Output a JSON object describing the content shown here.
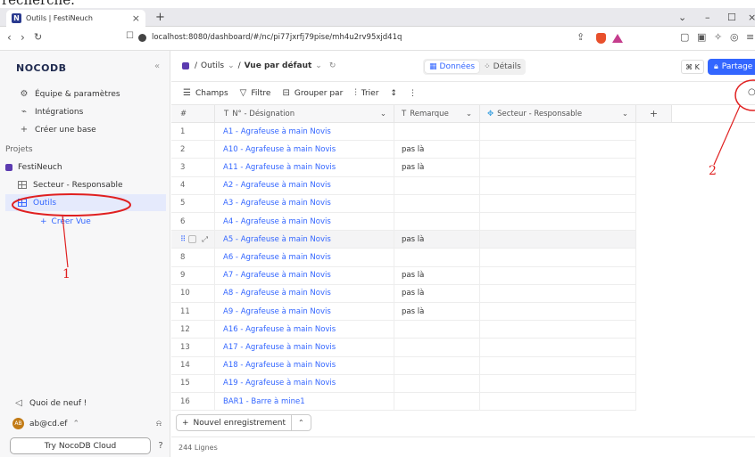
{
  "top_text": "recherche.",
  "browser": {
    "tab_title": "Outils | FestiNeuch",
    "favicon": "N",
    "url": "localhost:8080/dashboard/#/nc/pi77jxrfj79pise/mh4u2rv95xjd41q"
  },
  "sidebar": {
    "logo": "NOCODB",
    "items": [
      {
        "label": "Équipe & paramètres",
        "icon": "gear-icon"
      },
      {
        "label": "Intégrations",
        "icon": "plug-icon"
      },
      {
        "label": "Créer une base",
        "icon": "plus-icon"
      }
    ],
    "projects_heading": "Projets",
    "project_name": "FestiNeuch",
    "tables": [
      "Secteur - Responsable",
      "Outils"
    ],
    "create_view": "Créer Vue",
    "whats_new": "Quoi de neuf !",
    "user": "ab@cd.ef",
    "user_initials": "AB",
    "try_cloud": "Try NocoDB Cloud"
  },
  "topbar": {
    "table": "Outils",
    "view": "Vue par défaut",
    "tab_data": "Données",
    "tab_details": "Détails",
    "shortcut": "⌘ K",
    "share": "Partage"
  },
  "toolbar": {
    "fields": "Champs",
    "filter": "Filtre",
    "group": "Grouper par",
    "sort": "Trier"
  },
  "grid": {
    "columns": [
      "#",
      "N° - Désignation",
      "Remarque",
      "Secteur - Responsable"
    ],
    "rows": [
      {
        "n": "1",
        "des": "A1 - Agrafeuse à main Novis",
        "rem": ""
      },
      {
        "n": "2",
        "des": "A10 - Agrafeuse à main Novis",
        "rem": "pas là"
      },
      {
        "n": "3",
        "des": "A11 - Agrafeuse à main Novis",
        "rem": "pas là"
      },
      {
        "n": "4",
        "des": "A2 - Agrafeuse à main Novis",
        "rem": ""
      },
      {
        "n": "5",
        "des": "A3 - Agrafeuse à main Novis",
        "rem": ""
      },
      {
        "n": "6",
        "des": "A4 - Agrafeuse à main Novis",
        "rem": ""
      },
      {
        "n": "7",
        "des": "A5 - Agrafeuse à main Novis",
        "rem": "pas là"
      },
      {
        "n": "8",
        "des": "A6 - Agrafeuse à main Novis",
        "rem": ""
      },
      {
        "n": "9",
        "des": "A7 - Agrafeuse à main Novis",
        "rem": "pas là"
      },
      {
        "n": "10",
        "des": "A8 - Agrafeuse à main Novis",
        "rem": "pas là"
      },
      {
        "n": "11",
        "des": "A9 - Agrafeuse à main Novis",
        "rem": "pas là"
      },
      {
        "n": "12",
        "des": "A16 - Agrafeuse à main Novis",
        "rem": ""
      },
      {
        "n": "13",
        "des": "A17 - Agrafeuse à main Novis",
        "rem": ""
      },
      {
        "n": "14",
        "des": "A18 - Agrafeuse à main Novis",
        "rem": ""
      },
      {
        "n": "15",
        "des": "A19 - Agrafeuse à main Novis",
        "rem": ""
      },
      {
        "n": "16",
        "des": "BAR1 - Barre à mine1",
        "rem": ""
      }
    ],
    "new_record": "Nouvel enregistrement",
    "count": "244 Lignes"
  },
  "annotations": {
    "one": "1",
    "two": "2",
    "color": "#e02020"
  }
}
